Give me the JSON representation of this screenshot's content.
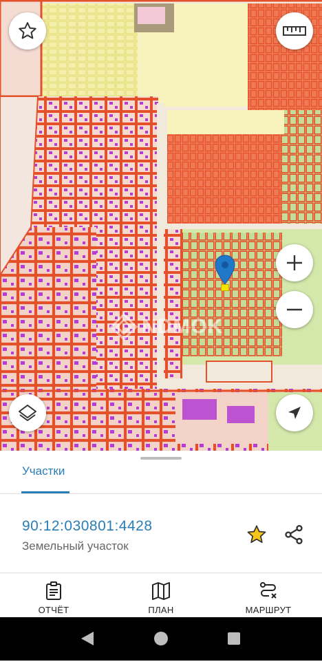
{
  "map": {
    "watermark": "NDMOK",
    "buttons": {
      "favorite": "star-icon",
      "ruler": "ruler-icon",
      "zoom_in": "plus-icon",
      "zoom_out": "minus-icon",
      "layers": "layers-icon",
      "locate": "navigation-arrow-icon"
    },
    "colors": {
      "parcel_outline": "#e8572e",
      "building": "#b43cd2",
      "green_zone": "#cfe6a8",
      "yellow_zone": "#f7f2b6",
      "pin": "#1f78c8",
      "selected_parcel": "#f5e400"
    }
  },
  "sheet": {
    "tab_label": "Участки",
    "cadastral_number": "90:12:030801:4428",
    "object_type": "Земельный участок",
    "favorite_icon": "star-icon",
    "share_icon": "share-icon",
    "favorite_color": "#f5c518"
  },
  "bottom_nav": [
    {
      "label": "ОТЧЁТ",
      "icon": "report-icon"
    },
    {
      "label": "ПЛАН",
      "icon": "map-icon"
    },
    {
      "label": "МАРШРУТ",
      "icon": "route-icon"
    }
  ],
  "system_nav": [
    "back-icon",
    "home-icon",
    "recents-icon"
  ]
}
